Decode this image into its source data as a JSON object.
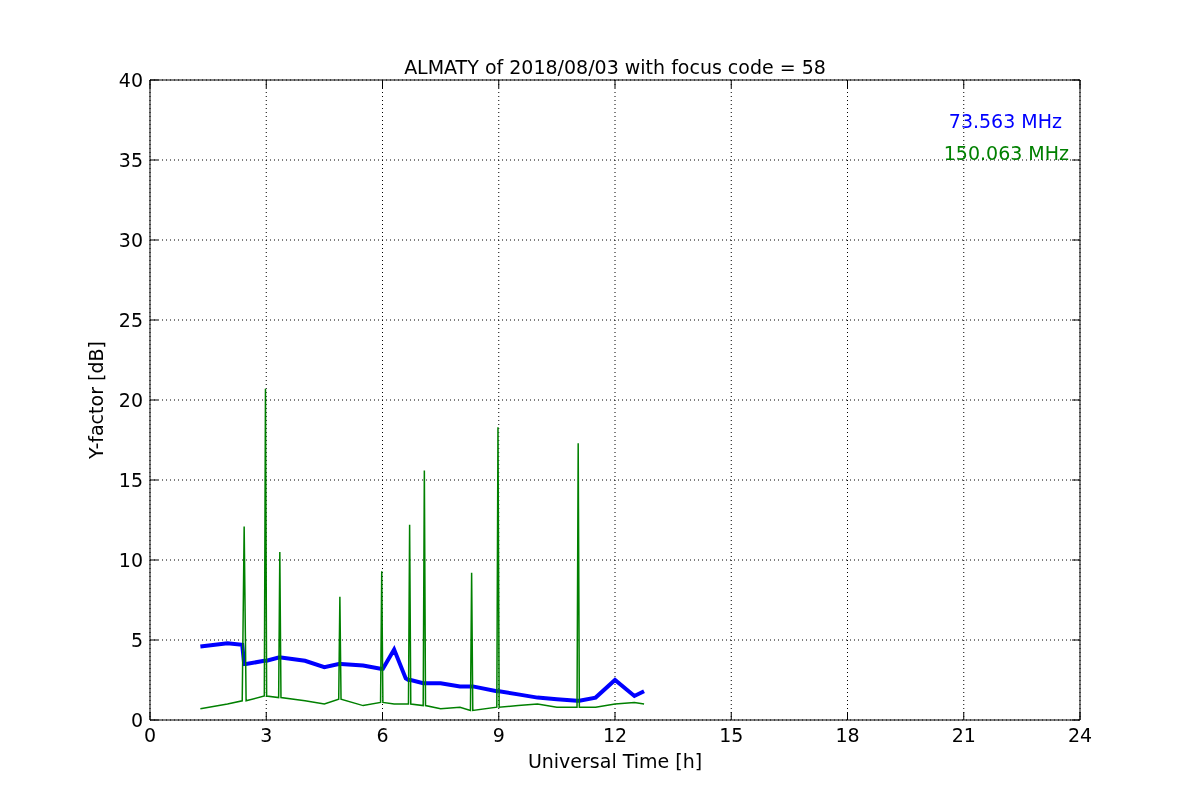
{
  "chart_data": {
    "type": "line",
    "title": "ALMATY of 2018/08/03 with focus code = 58",
    "xlabel": "Universal Time [h]",
    "ylabel": "Y-factor [dB]",
    "xlim": [
      0,
      24
    ],
    "ylim": [
      0,
      40
    ],
    "xticks": [
      0,
      3,
      6,
      9,
      12,
      15,
      18,
      21,
      24
    ],
    "yticks": [
      0,
      5,
      10,
      15,
      20,
      25,
      30,
      35,
      40
    ],
    "grid": true,
    "x": [
      1.3,
      2.0,
      2.38,
      2.43,
      2.48,
      2.95,
      2.98,
      3.01,
      3.32,
      3.35,
      3.38,
      4.0,
      4.5,
      4.87,
      4.9,
      4.93,
      5.5,
      5.95,
      5.98,
      6.01,
      6.3,
      6.6,
      6.67,
      6.7,
      6.73,
      7.05,
      7.08,
      7.11,
      7.5,
      8.0,
      8.27,
      8.3,
      8.33,
      8.95,
      8.98,
      9.01,
      9.5,
      10.0,
      10.5,
      11.02,
      11.05,
      11.08,
      11.5,
      12.0,
      12.5,
      12.75
    ],
    "series": [
      {
        "name": "73.563 MHz",
        "color": "#0000ff",
        "values": [
          4.6,
          4.8,
          4.7,
          3.5,
          3.5,
          3.7,
          3.7,
          3.7,
          3.9,
          3.9,
          3.9,
          3.7,
          3.3,
          3.5,
          3.5,
          3.5,
          3.4,
          3.2,
          3.2,
          3.2,
          4.4,
          2.6,
          2.5,
          2.5,
          2.5,
          2.3,
          2.3,
          2.3,
          2.3,
          2.1,
          2.1,
          2.1,
          2.1,
          1.8,
          1.8,
          1.8,
          1.6,
          1.4,
          1.3,
          1.2,
          1.2,
          1.2,
          1.4,
          2.5,
          1.5,
          1.8
        ]
      },
      {
        "name": "150.063 MHz",
        "color": "#008000",
        "values": [
          0.7,
          1.0,
          1.2,
          12.1,
          1.2,
          1.5,
          20.7,
          1.5,
          1.4,
          10.5,
          1.4,
          1.2,
          1.0,
          1.3,
          7.7,
          1.3,
          0.9,
          1.1,
          9.3,
          1.1,
          1.0,
          1.0,
          1.0,
          12.2,
          1.0,
          0.9,
          15.6,
          0.9,
          0.7,
          0.8,
          0.6,
          9.2,
          0.6,
          0.8,
          18.3,
          0.8,
          0.9,
          1.0,
          0.8,
          0.8,
          17.3,
          0.8,
          0.8,
          1.0,
          1.1,
          1.0
        ]
      }
    ]
  }
}
